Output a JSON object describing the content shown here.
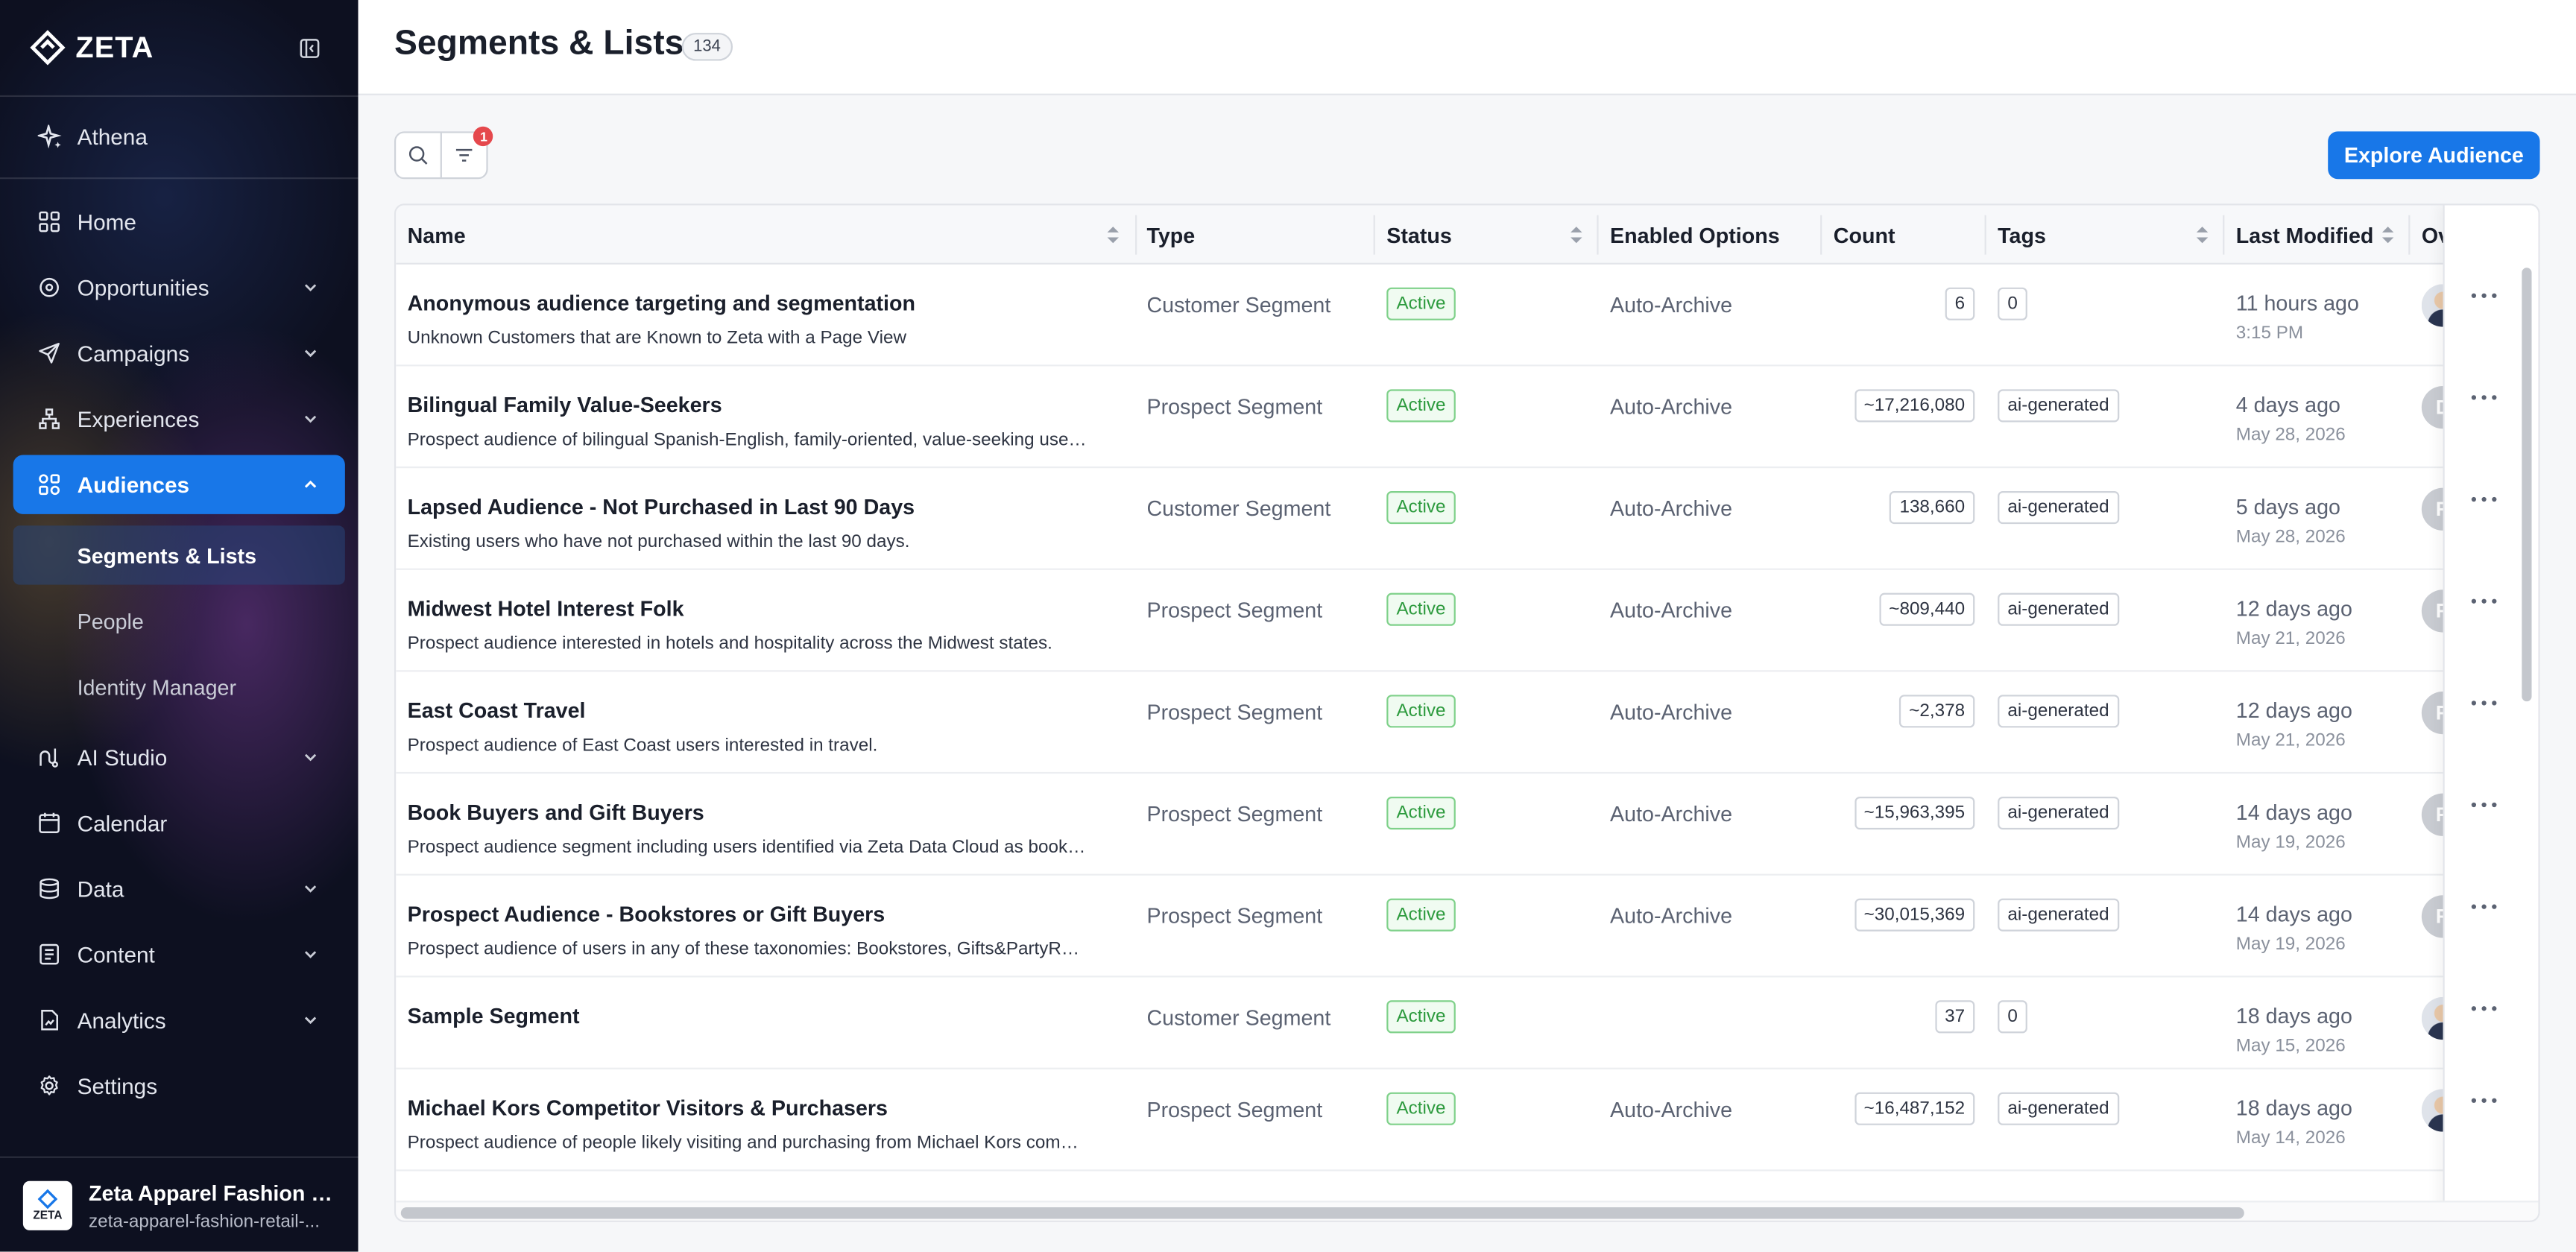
{
  "app": {
    "brand": "ZETA"
  },
  "sidebar": {
    "athena": "Athena",
    "items": [
      {
        "label": "Home",
        "icon": "home-grid-icon"
      },
      {
        "label": "Opportunities",
        "icon": "target-icon"
      },
      {
        "label": "Campaigns",
        "icon": "send-icon"
      },
      {
        "label": "Experiences",
        "icon": "hierarchy-icon"
      },
      {
        "label": "Audiences",
        "icon": "audiences-icon",
        "active": true
      },
      {
        "label": "AI Studio",
        "icon": "ai-studio-icon"
      },
      {
        "label": "Calendar",
        "icon": "calendar-icon"
      },
      {
        "label": "Data",
        "icon": "database-icon"
      },
      {
        "label": "Content",
        "icon": "content-icon"
      },
      {
        "label": "Analytics",
        "icon": "analytics-icon"
      },
      {
        "label": "Settings",
        "icon": "gear-icon"
      }
    ],
    "audience_sub": [
      "Segments & Lists",
      "People",
      "Identity Manager"
    ],
    "workspace": {
      "logo_text": "ZETA",
      "name": "Zeta Apparel Fashion Re...",
      "slug": "zeta-apparel-fashion-retail-..."
    }
  },
  "header": {
    "title": "Segments & Lists",
    "count": "134"
  },
  "toolbar": {
    "filter_count": "1",
    "explore_label": "Explore Audience"
  },
  "table": {
    "columns": {
      "name": "Name",
      "type": "Type",
      "status": "Status",
      "options": "Enabled Options",
      "count": "Count",
      "tags": "Tags",
      "modified": "Last Modified",
      "owner": "Ov"
    },
    "rows": [
      {
        "name": "Anonymous audience targeting and segmentation",
        "desc": "Unknown Customers that are Known to Zeta with a Page View",
        "type": "Customer Segment",
        "status": "Active",
        "options": "Auto-Archive",
        "count": "6",
        "tag": "0",
        "modified": "11 hours ago",
        "modified_sub": "3:15 PM",
        "avatar": ""
      },
      {
        "name": "Bilingual Family Value-Seekers",
        "desc": "Prospect audience of bilingual Spanish-English, family-oriented, value-seeking users f...",
        "type": "Prospect Segment",
        "status": "Active",
        "options": "Auto-Archive",
        "count": "~17,216,080",
        "tag": "ai-generated",
        "modified": "4 days ago",
        "modified_sub": "May 28, 2026",
        "avatar": "D"
      },
      {
        "name": "Lapsed Audience - Not Purchased in Last 90 Days",
        "desc": "Existing users who have not purchased within the last 90 days.",
        "type": "Customer Segment",
        "status": "Active",
        "options": "Auto-Archive",
        "count": "138,660",
        "tag": "ai-generated",
        "modified": "5 days ago",
        "modified_sub": "May 28, 2026",
        "avatar": "R"
      },
      {
        "name": "Midwest Hotel Interest Folk",
        "desc": "Prospect audience interested in hotels and hospitality across the Midwest states.",
        "type": "Prospect Segment",
        "status": "Active",
        "options": "Auto-Archive",
        "count": "~809,440",
        "tag": "ai-generated",
        "modified": "12 days ago",
        "modified_sub": "May 21, 2026",
        "avatar": "R"
      },
      {
        "name": "East Coast Travel",
        "desc": "Prospect audience of East Coast users interested in travel.",
        "type": "Prospect Segment",
        "status": "Active",
        "options": "Auto-Archive",
        "count": "~2,378",
        "tag": "ai-generated",
        "modified": "12 days ago",
        "modified_sub": "May 21, 2026",
        "avatar": "R"
      },
      {
        "name": "Book Buyers and Gift Buyers",
        "desc": "Prospect audience segment including users identified via Zeta Data Cloud as book buy...",
        "type": "Prospect Segment",
        "status": "Active",
        "options": "Auto-Archive",
        "count": "~15,963,395",
        "tag": "ai-generated",
        "modified": "14 days ago",
        "modified_sub": "May 19, 2026",
        "avatar": "R"
      },
      {
        "name": "Prospect Audience - Bookstores or Gift Buyers",
        "desc": "Prospect audience of users in any of these taxonomies: Bookstores, Gifts&PartyRetail...",
        "type": "Prospect Segment",
        "status": "Active",
        "options": "Auto-Archive",
        "count": "~30,015,369",
        "tag": "ai-generated",
        "modified": "14 days ago",
        "modified_sub": "May 19, 2026",
        "avatar": "R"
      },
      {
        "name": "Sample Segment",
        "desc": "",
        "type": "Customer Segment",
        "status": "Active",
        "options": "",
        "count": "37",
        "tag": "0",
        "modified": "18 days ago",
        "modified_sub": "May 15, 2026",
        "avatar": ""
      },
      {
        "name": "Michael Kors Competitor Visitors & Purchasers",
        "desc": "Prospect audience of people likely visiting and purchasing from Michael Kors competi...",
        "type": "Prospect Segment",
        "status": "Active",
        "options": "Auto-Archive",
        "count": "~16,487,152",
        "tag": "ai-generated",
        "modified": "18 days ago",
        "modified_sub": "May 14, 2026",
        "avatar": ""
      }
    ]
  },
  "colors": {
    "accent": "#1877e8",
    "active_green": "#2c9a3d",
    "sidebar_bg": "#0d1020",
    "badge_red": "#e5484d"
  }
}
